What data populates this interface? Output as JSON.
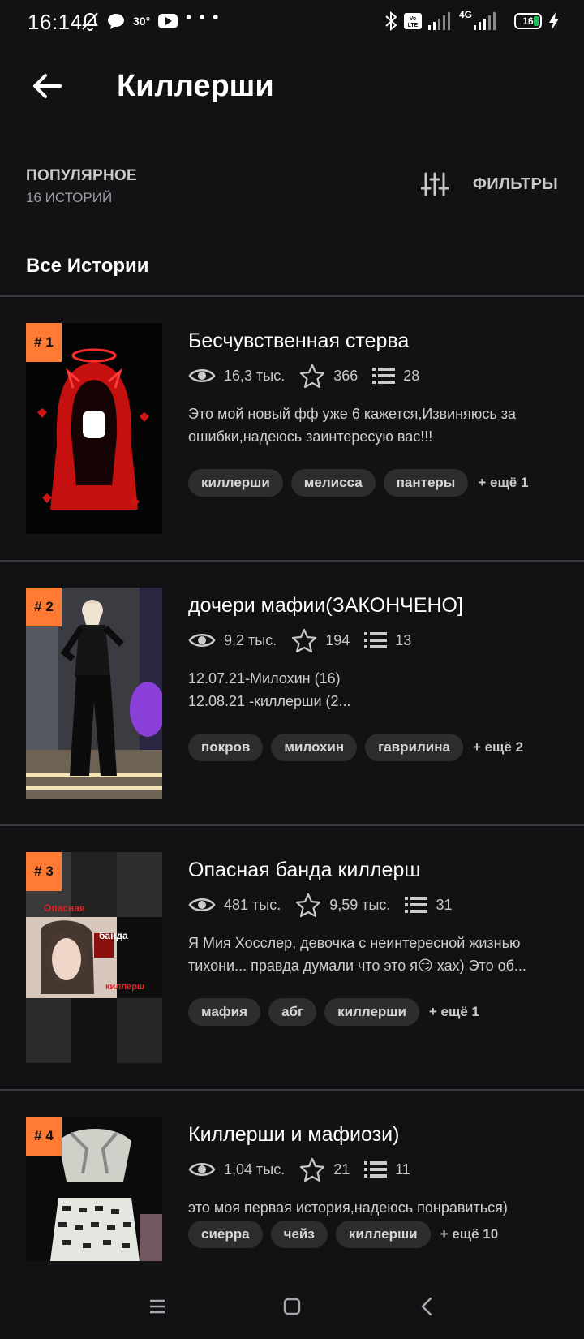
{
  "status_bar": {
    "time": "16:14",
    "temperature": "30°",
    "more_dots": "• • •",
    "network": "4G",
    "battery": "16",
    "icons": [
      "bell-off-icon",
      "chat-icon",
      "youtube-icon",
      "bluetooth-icon",
      "volte-icon",
      "signal-icon",
      "signal-icon",
      "battery-icon",
      "charging-icon"
    ]
  },
  "header": {
    "title": "Киллерши",
    "back_icon": "arrow-left-icon"
  },
  "sort": {
    "label": "ПОПУЛЯРНОЕ",
    "count": "16 ИСТОРИЙ"
  },
  "filters": {
    "label": "ФИЛЬТРЫ",
    "icon": "sliders-icon"
  },
  "section_title": "Все Истории",
  "accent_color": "#ff7a33",
  "stories": [
    {
      "rank": "# 1",
      "title": "Бесчувственная стерва",
      "views": "16,3 тыс.",
      "votes": "366",
      "parts": "28",
      "description": "Это мой новый фф уже 6 кажется,Извиняюсь за ошибки,надеюсь заинтересую вас!!!",
      "tags": [
        "киллерши",
        "мелисса",
        "пантеры"
      ],
      "more_tags": "+ ещё 1"
    },
    {
      "rank": "# 2",
      "title": "дочери мафии(ЗАКОНЧЕНО]",
      "views": "9,2 тыс.",
      "votes": "194",
      "parts": "13",
      "description_lines": [
        "12.07.21-Милохин  (16)",
        "12.08.21 -киллерши (2..."
      ],
      "tags": [
        "покров",
        "милохин",
        "гаврилина"
      ],
      "more_tags": "+ ещё 2"
    },
    {
      "rank": "# 3",
      "title": "Опасная банда киллерш",
      "views": "481 тыс.",
      "votes": "9,59 тыс.",
      "parts": "31",
      "description_lines": [
        "Я Мия Хосслер, девочка с неинтересной жизнью",
        "тихони...  правда думали что это я😏 хах) Это об..."
      ],
      "cover_texts": [
        "Опасная",
        "банда",
        "киллерш"
      ],
      "tags": [
        "мафия",
        "абг",
        "киллерши"
      ],
      "more_tags": "+ ещё 1"
    },
    {
      "rank": "# 4",
      "title": "Киллерши и мафиози)",
      "views": "1,04 тыс.",
      "votes": "21",
      "parts": "11",
      "description": "это моя первая история,надеюсь понравиться)",
      "tags": [
        "сиерра",
        "чейз",
        "киллерши"
      ],
      "more_tags": "+ ещё 10"
    }
  ],
  "nav_bar": {
    "icons": [
      "menu-icon",
      "home-square-icon",
      "back-chevron-icon"
    ]
  }
}
